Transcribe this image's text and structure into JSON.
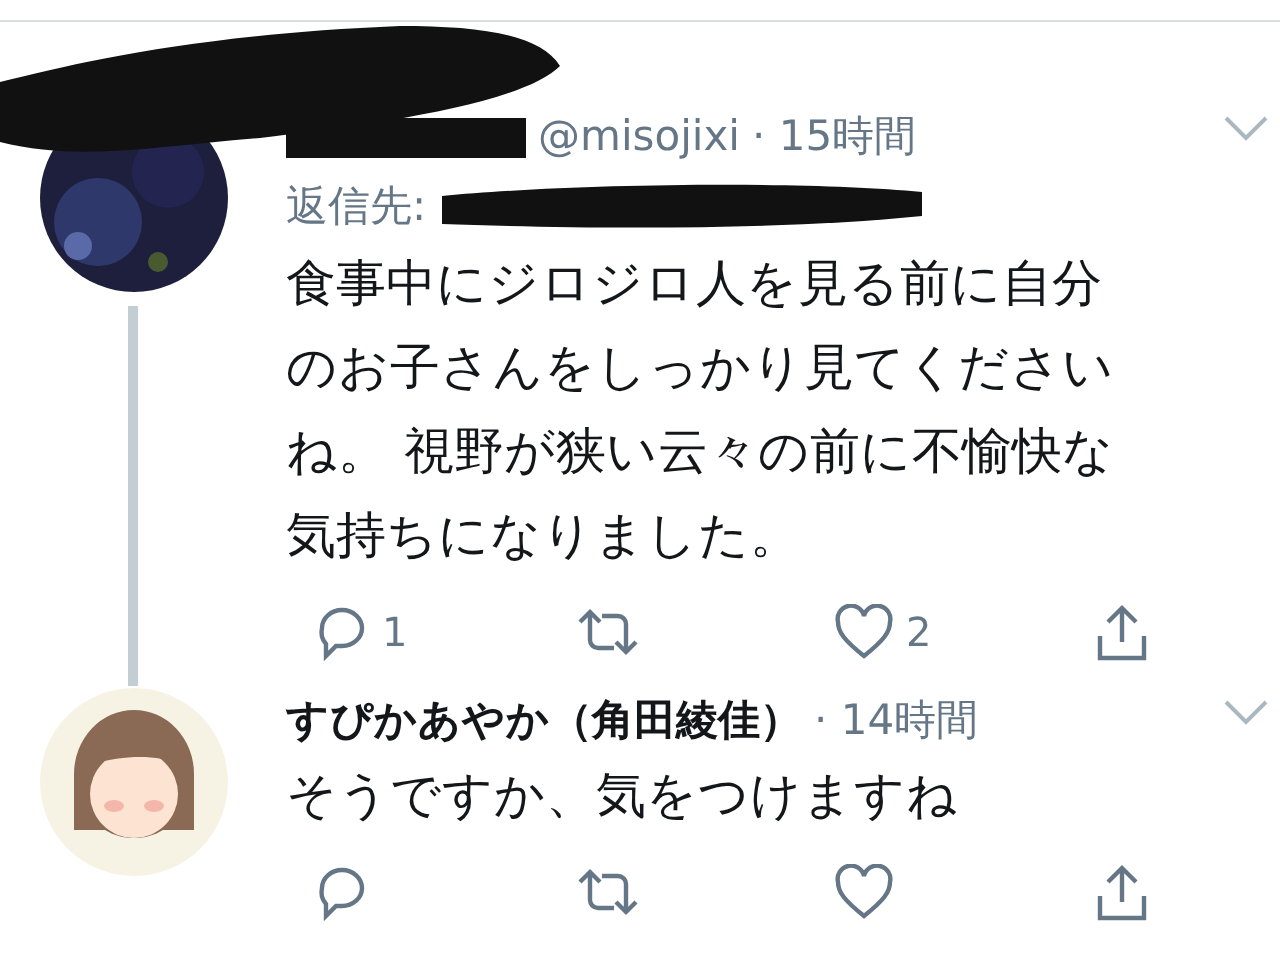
{
  "tweets": [
    {
      "kind": "redacted",
      "handle": "@misojixi",
      "time": "· 15時間",
      "reply_label": "返信先:",
      "text_lines": [
        "食事中にジロジロ人を見る前に自分",
        "のお子さんをしっかり見てください",
        "ね。 視野が狭い云々の前に不愉快な",
        "気持ちになりました。"
      ],
      "thread": true,
      "actions": {
        "reply": "1",
        "like": "2"
      }
    },
    {
      "kind": "plain",
      "name": "すぴかあやか（角田綾佳）",
      "time": "· 14時間",
      "text_lines": [
        "そうですか、気をつけますね"
      ],
      "thread": false
    }
  ]
}
